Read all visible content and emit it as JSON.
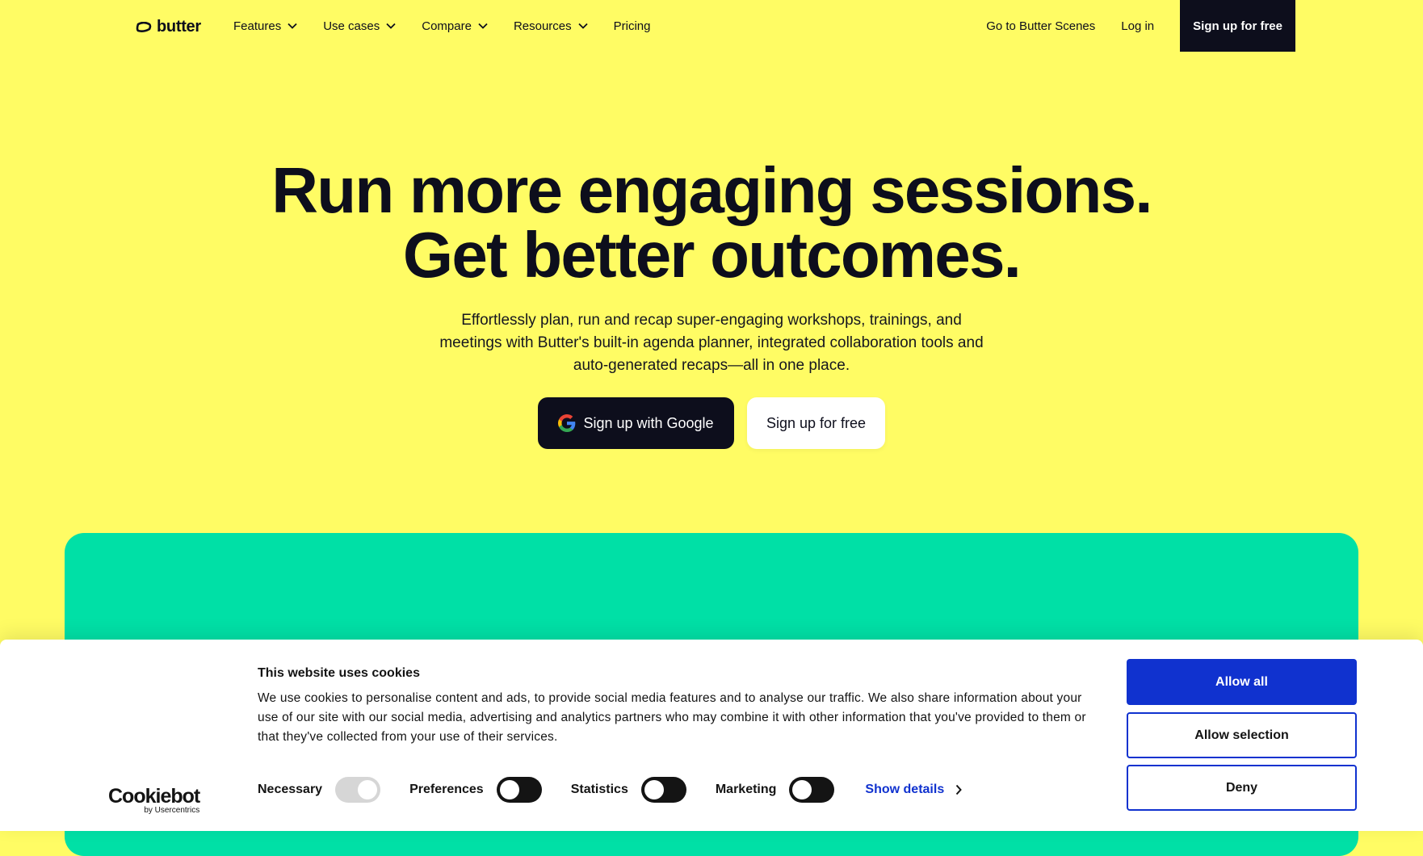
{
  "nav": {
    "logo_text": "butter",
    "items": [
      {
        "label": "Features",
        "dropdown": true
      },
      {
        "label": "Use cases",
        "dropdown": true
      },
      {
        "label": "Compare",
        "dropdown": true
      },
      {
        "label": "Resources",
        "dropdown": true
      },
      {
        "label": "Pricing",
        "dropdown": false
      }
    ],
    "scenes_link": "Go to Butter Scenes",
    "login_link": "Log in",
    "cta": "Sign up for free"
  },
  "hero": {
    "title_line1": "Run more engaging sessions.",
    "title_line2": "Get better outcomes.",
    "subtitle": "Effortlessly plan, run and recap super-engaging workshops, trainings, and meetings with Butter's built-in agenda planner, integrated collaboration tools and auto-generated recaps—all in one place.",
    "google_button": "Sign up with Google",
    "free_button": "Sign up for free"
  },
  "cookie_banner": {
    "brand": "Cookiebot",
    "brand_by": "by Usercentrics",
    "title": "This website uses cookies",
    "text": "We use cookies to personalise content and ads, to provide social media features and to analyse our traffic. We also share information about your use of our site with our social media, advertising and analytics partners who may combine it with other information that you've provided to them or that they've collected from your use of their services.",
    "toggles": [
      {
        "label": "Necessary",
        "checked": true,
        "disabled": true
      },
      {
        "label": "Preferences",
        "checked": false
      },
      {
        "label": "Statistics",
        "checked": false
      },
      {
        "label": "Marketing",
        "checked": false
      }
    ],
    "show_details": "Show details",
    "allow_all": "Allow all",
    "allow_selection": "Allow selection",
    "deny": "Deny"
  },
  "colors": {
    "background": "#fffc64",
    "dark": "#0d0e1c",
    "green_card": "#00e0a6",
    "cookie_blue": "#1032cf"
  }
}
